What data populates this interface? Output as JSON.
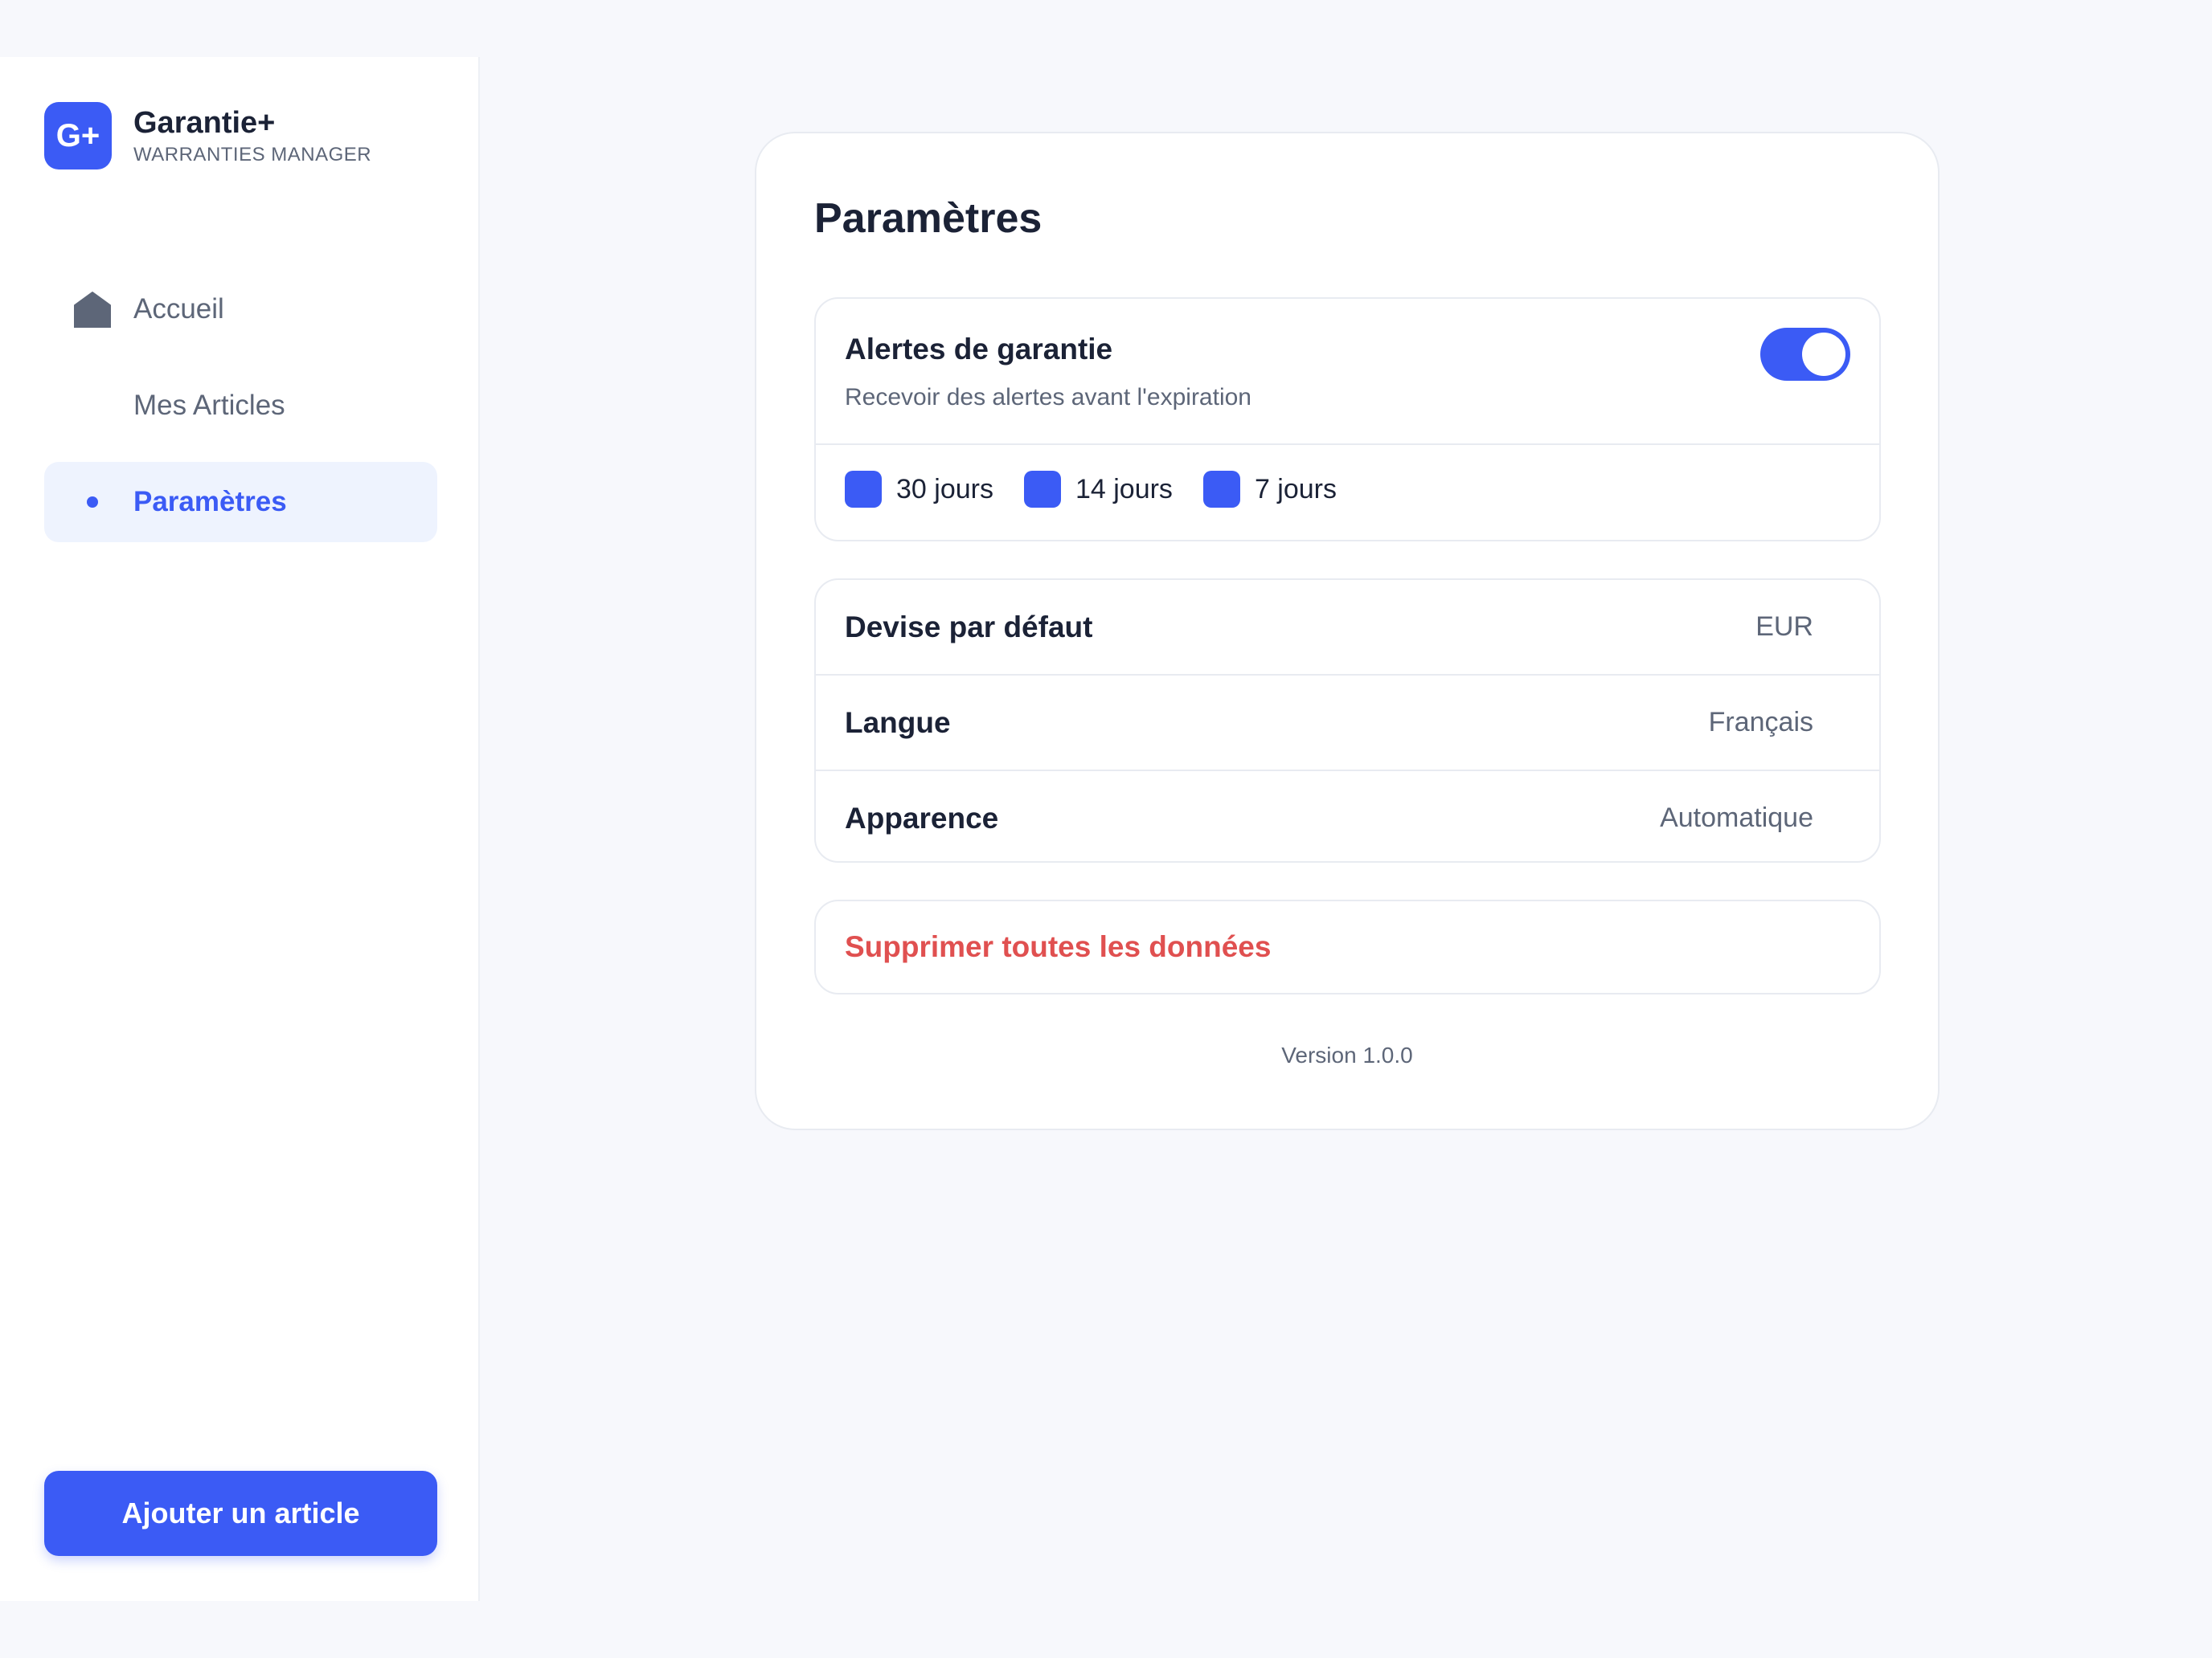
{
  "app": {
    "logo_text": "G+",
    "name": "Garantie+",
    "subtitle": "WARRANTIES MANAGER"
  },
  "sidebar": {
    "items": [
      {
        "label": "Accueil",
        "icon": "home-icon",
        "active": false
      },
      {
        "label": "Mes Articles",
        "icon": "",
        "active": false
      },
      {
        "label": "Paramètres",
        "icon": "dot-icon",
        "active": true
      }
    ],
    "add_button_label": "Ajouter un article"
  },
  "settings": {
    "title": "Paramètres",
    "alerts": {
      "title": "Alertes de garantie",
      "subtitle": "Recevoir des alertes avant l'expiration",
      "enabled": true,
      "options": [
        {
          "label": "30 jours",
          "checked": true
        },
        {
          "label": "14 jours",
          "checked": true
        },
        {
          "label": "7 jours",
          "checked": true
        }
      ]
    },
    "preferences": [
      {
        "label": "Devise par défaut",
        "value": "EUR"
      },
      {
        "label": "Langue",
        "value": "Français"
      },
      {
        "label": "Apparence",
        "value": "Automatique"
      }
    ],
    "danger_label": "Supprimer toutes les données",
    "version": "Version 1.0.0"
  },
  "colors": {
    "accent": "#3b5bf5",
    "danger": "#e05050",
    "background": "#f7f8fc"
  }
}
